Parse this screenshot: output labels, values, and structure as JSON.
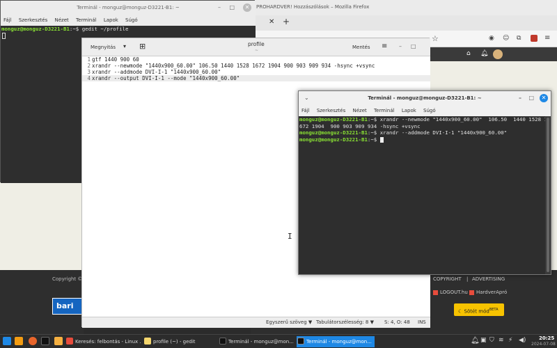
{
  "firefox": {
    "title": "PROHARDVER! Hozzászólások – Mozilla Firefox",
    "footer_links": {
      "copyright": "COPYRIGHT",
      "separator": "|",
      "advertising": "ADVERTISING"
    },
    "logout": "LOGOUT.hu",
    "hardverapro": "HardverApró",
    "dark_mode": "Sötét mód",
    "dark_mode_badge": "BETA",
    "copyright_left": "Copyright ©",
    "bario_logo": "bari"
  },
  "term1": {
    "title": "Terminál - monguz@monguz-D3221-B1: ~",
    "menu": [
      "Fájl",
      "Szerkesztés",
      "Nézet",
      "Terminál",
      "Lapok",
      "Súgó"
    ],
    "prompt": "monguz@monguz-D3221-B1",
    "prompt_suffix": ":~$",
    "command": " gedit ~/profile"
  },
  "gedit": {
    "open_label": "Megnyitás",
    "title": "profile",
    "subtitle": "~",
    "save_label": "Mentés",
    "lines": [
      {
        "n": "1",
        "text": "gtf 1440 900 60"
      },
      {
        "n": "2",
        "text": "xrandr --newmode \"1440x900_60.00\"  106.50  1440 1528 1672 1904  900 903 909 934 -hsync +vsync"
      },
      {
        "n": "3",
        "text": "xrandr --addmode DVI-I-1 \"1440x900_60.00\""
      },
      {
        "n": "4",
        "text": "xrandr --output DVI-I-1 --mode \"1440x900_60.00\""
      }
    ],
    "status": {
      "text_mode": "Egyszerű szöveg",
      "tab_width": "Tabulátorszélesség: 8",
      "position": "S: 4, O: 48",
      "ins": "INS"
    }
  },
  "term2": {
    "title": "Terminál - monguz@monguz-D3221-B1: ~",
    "menu": [
      "Fájl",
      "Szerkesztés",
      "Nézet",
      "Terminál",
      "Lapok",
      "Súgó"
    ],
    "prompt": "monguz@monguz-D3221-B1",
    "prompt_suffix": ":~$",
    "line1_cmd": " xrandr --newmode \"1440x900_60.00\"  106.50  1440 1528 1",
    "line2": "672 1904  900 903 909 934 -hsync +vsync",
    "line3_cmd": " xrandr --addmode DVI-I-1 \"1440x900_60.00\"",
    "line4_cmd": " "
  },
  "taskbar": {
    "tasks": [
      {
        "label": "Keresés: felbontás - Linux ..."
      },
      {
        "label": "profile (~) - gedit"
      },
      {
        "label": "Terminál - monguz@mon..."
      },
      {
        "label": "Terminál - monguz@mon..."
      }
    ],
    "time": "20:25",
    "date": "2024-07-08"
  },
  "colors": {
    "prompt_green": "#8ae234",
    "taskbar_active": "#1e88e5",
    "dark_mode_button": "#f7c300"
  }
}
